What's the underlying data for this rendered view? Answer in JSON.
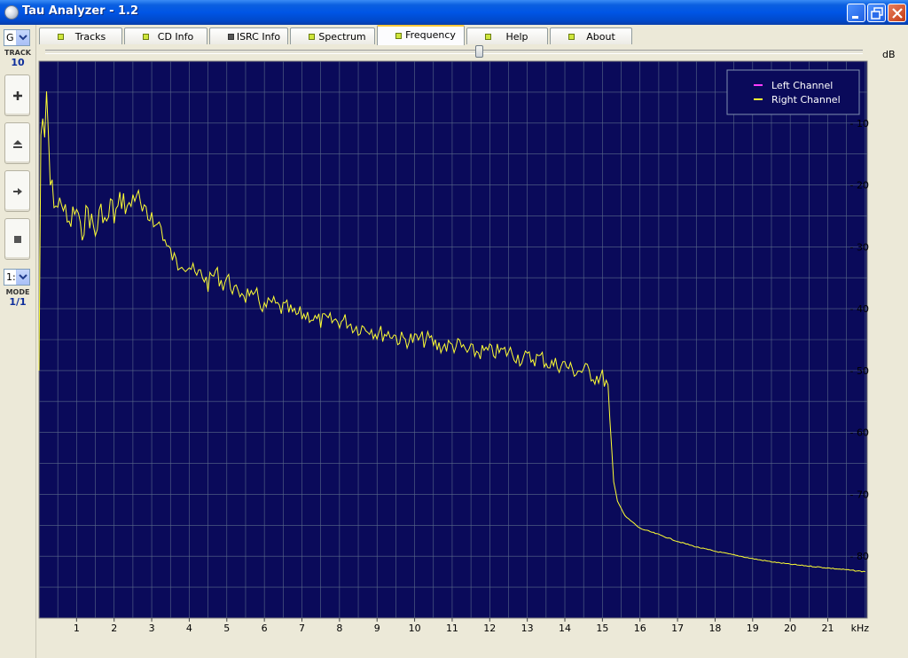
{
  "window": {
    "title": "Tau Analyzer - 1.2",
    "title_color": "#0055e5"
  },
  "toolbar": {
    "drive_select": "G",
    "track_caption": "TRACK",
    "track_value": "10",
    "buttons": [
      {
        "name": "add",
        "icon": "plus-icon"
      },
      {
        "name": "eject",
        "icon": "eject-icon"
      },
      {
        "name": "next",
        "icon": "arrow-right-icon"
      },
      {
        "name": "stop",
        "icon": "stop-square-icon"
      }
    ],
    "mode_select": "1:",
    "mode_caption": "MODE",
    "mode_value": "1/1"
  },
  "tabs": [
    {
      "label": "Tracks",
      "led": "green",
      "active": false
    },
    {
      "label": "CD Info",
      "led": "green",
      "active": false
    },
    {
      "label": "ISRC Info",
      "led": "gray",
      "active": false
    },
    {
      "label": "Spectrum",
      "led": "green",
      "active": false
    },
    {
      "label": "Frequency",
      "led": "green",
      "active": true
    },
    {
      "label": "Help",
      "led": "green",
      "active": false
    },
    {
      "label": "About",
      "led": "green",
      "active": false
    }
  ],
  "slider": {
    "position_fraction": 0.53
  },
  "chart_data": {
    "type": "line",
    "x_unit": "kHz",
    "y_unit": "dB",
    "x_ticks": [
      1,
      2,
      3,
      4,
      5,
      6,
      7,
      8,
      9,
      10,
      11,
      12,
      13,
      14,
      15,
      16,
      17,
      18,
      19,
      20,
      21
    ],
    "y_ticks": [
      10,
      20,
      30,
      40,
      50,
      60,
      70,
      80
    ],
    "xlim": [
      0,
      22.05
    ],
    "ylim": [
      0,
      90
    ],
    "y_inverted": true,
    "grid": true,
    "background_color": "#0a0a5a",
    "grid_color": "#5a6a8a",
    "legend_position": "top-right",
    "legend": [
      {
        "label": "Left Channel",
        "color": "#ff3cff"
      },
      {
        "label": "Right Channel",
        "color": "#ffff33"
      }
    ],
    "series": [
      {
        "name": "Right Channel",
        "color": "#ffff33",
        "x": [
          0.0,
          0.05,
          0.1,
          0.15,
          0.2,
          0.25,
          0.3,
          0.4,
          0.5,
          0.6,
          0.7,
          0.8,
          0.9,
          1.0,
          1.1,
          1.2,
          1.3,
          1.4,
          1.5,
          1.6,
          1.7,
          1.8,
          1.9,
          2.0,
          2.1,
          2.2,
          2.3,
          2.4,
          2.5,
          2.6,
          2.7,
          2.8,
          2.9,
          3.0,
          3.1,
          3.2,
          3.3,
          3.4,
          3.5,
          3.6,
          3.7,
          3.8,
          3.9,
          4.0,
          4.1,
          4.2,
          4.3,
          4.4,
          4.5,
          4.6,
          4.7,
          4.8,
          4.9,
          5.0,
          5.1,
          5.2,
          5.3,
          5.4,
          5.5,
          5.6,
          5.7,
          5.8,
          5.9,
          6.0,
          6.2,
          6.4,
          6.6,
          6.8,
          7.0,
          7.2,
          7.4,
          7.6,
          7.8,
          8.0,
          8.2,
          8.4,
          8.6,
          8.8,
          9.0,
          9.2,
          9.4,
          9.6,
          9.8,
          10.0,
          10.2,
          10.4,
          10.6,
          10.8,
          11.0,
          11.2,
          11.4,
          11.6,
          11.8,
          12.0,
          12.2,
          12.4,
          12.6,
          12.8,
          13.0,
          13.2,
          13.4,
          13.6,
          13.8,
          14.0,
          14.2,
          14.4,
          14.6,
          14.8,
          15.0,
          15.1,
          15.15,
          15.2,
          15.25,
          15.3,
          15.4,
          15.6,
          15.8,
          16.0,
          16.5,
          17.0,
          17.5,
          18.0,
          18.5,
          19.0,
          19.5,
          20.0,
          20.5,
          21.0,
          21.5,
          22.0
        ],
        "y": [
          50,
          12,
          9,
          14,
          6,
          12,
          20,
          22,
          24,
          22,
          25,
          27,
          25,
          24,
          28,
          26,
          24,
          26,
          28,
          25,
          24,
          27,
          23,
          25,
          24,
          22,
          23,
          24,
          22,
          21,
          24,
          25,
          26,
          24,
          27,
          26,
          28,
          30,
          31,
          32,
          33,
          32,
          33,
          33,
          34,
          35,
          34,
          35,
          36,
          35,
          34,
          35,
          36,
          35,
          36,
          37,
          38,
          37,
          38,
          37,
          39,
          38,
          39,
          40,
          39,
          40,
          40,
          41,
          41,
          41,
          42,
          42,
          42,
          42,
          42,
          43,
          43,
          43,
          44,
          44,
          44,
          45,
          45,
          45,
          45,
          45,
          46,
          46,
          46,
          46,
          47,
          47,
          47,
          47,
          47,
          47,
          47,
          48,
          48,
          48,
          48,
          49,
          49,
          49,
          50,
          50,
          50,
          51,
          51,
          52,
          53,
          58,
          63,
          68,
          71,
          73.5,
          74.5,
          75.5,
          76.5,
          77.6,
          78.5,
          79.2,
          79.8,
          80.4,
          80.9,
          81.3,
          81.6,
          81.9,
          82.2,
          82.5
        ]
      }
    ]
  }
}
